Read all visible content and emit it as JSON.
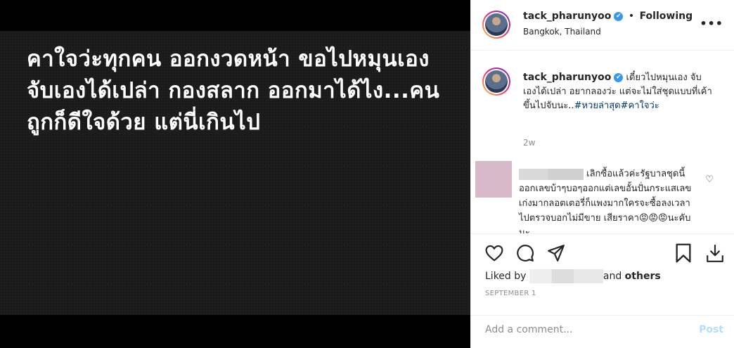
{
  "post": {
    "image_text": "คาใจว่ะทุกคน ออกงวดหน้า ขอไปหมุนเองจับเองได้เปล่า กองสลาก ออกมาได้ไง...คนถูกก็ดีใจด้วย แต่นี่เกินไป"
  },
  "header": {
    "username": "tack_pharunyoo",
    "verified_icon": "✔",
    "separator": "•",
    "follow_status": "Following",
    "location": "Bangkok, Thailand",
    "more": "•••"
  },
  "caption": {
    "username": "tack_pharunyoo",
    "text": "เดี๋ยวไปหมุนเอง จับเองได้เปล่า อยากลองว่ะ แต่จะไม่ใส่ชุดแบบที่เค้าขึ้นไปจับนะ..",
    "hashtags": "#หวยล่าสุด#คาใจว่ะ",
    "time": "2w"
  },
  "comment": {
    "text": "เลิกซื้อแล้วค่ะรัฐบาลชุดนี้ออกเลขบ้าๆบอๆออกแต่เลขอั้นปั่นกระแสเลขเก่งมากลอตเตอรี่ก็แพงมากใครจะซื้อลงเวลาไปตรวจบอกไม่มีขาย เสียราคา😡😡😡นะคับนะ",
    "like_icon": "♡"
  },
  "actions": {
    "like_icon": "heart-icon",
    "comment_icon": "comment-icon",
    "share_icon": "share-icon",
    "save_icon": "bookmark-icon",
    "download_icon": "download-icon"
  },
  "likes": {
    "prefix": "Liked by",
    "suffix": "and",
    "others": "others"
  },
  "date": "SEPTEMBER 1",
  "add_comment": {
    "placeholder": "Add a comment...",
    "post_label": "Post"
  }
}
